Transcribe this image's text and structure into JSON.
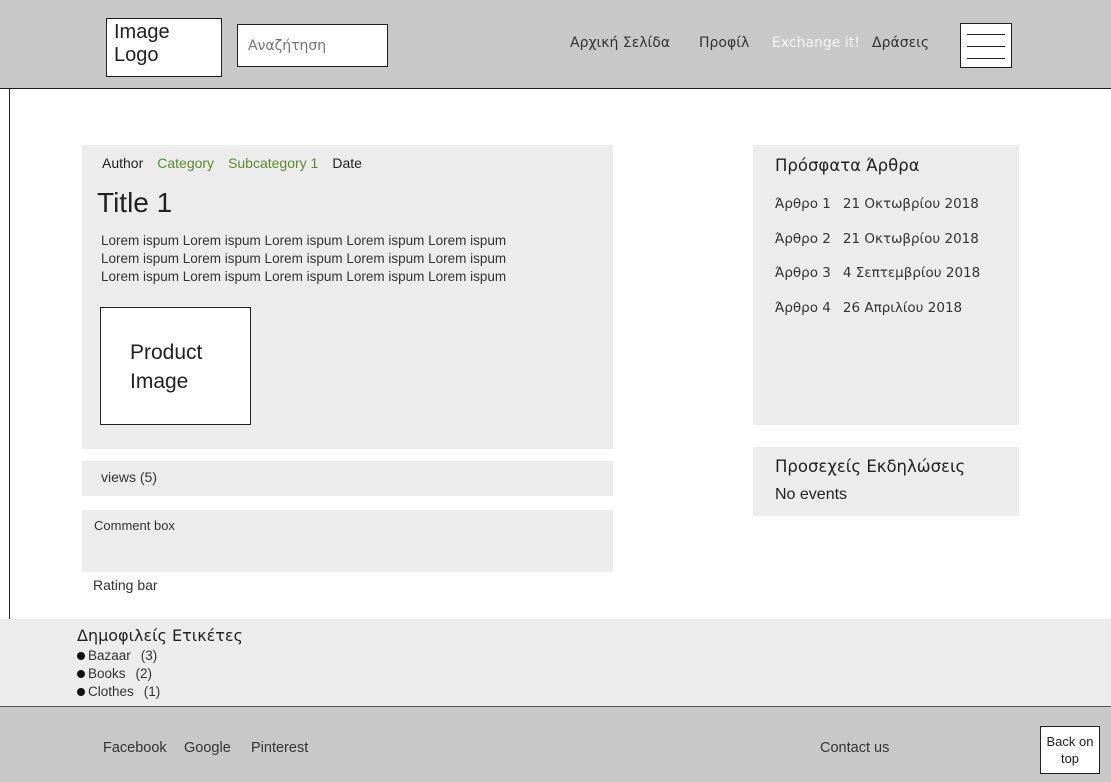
{
  "header": {
    "logo_text": "Image\nLogo",
    "search_placeholder": "Αναζήτηση",
    "nav": [
      "Αρχική Σελίδα",
      "Προφίλ",
      "Exchange it!",
      "Δράσεις"
    ],
    "menu_icon": "hamburger-menu-icon"
  },
  "post": {
    "meta": {
      "author": "Author",
      "category": "Category",
      "subcategory": "Subcategory 1",
      "date": "Date"
    },
    "title": "Title 1",
    "body": "Lorem ispum Lorem ispum Lorem ispum Lorem ispum Lorem ispum\nLorem ispum Lorem ispum Lorem ispum Lorem ispum Lorem ispum\nLorem ispum Lorem ispum Lorem ispum Lorem ispum Lorem ispum",
    "image_placeholder": "Product\nImage",
    "views": "views (5)",
    "comment_box": "Comment box",
    "rating_bar": "Rating bar"
  },
  "sidebar": {
    "recent_title": "Πρόσφατα Άρθρα",
    "recent": [
      {
        "title": "Άρθρο 1",
        "date": "21 Οκτωβρίου 2018"
      },
      {
        "title": "Άρθρο 2",
        "date": "21 Οκτωβρίου 2018"
      },
      {
        "title": "Άρθρο 3",
        "date": "4 Σεπτεμβρίου 2018"
      },
      {
        "title": "Άρθρο 4",
        "date": "26 Απριλίου 2018"
      }
    ],
    "events_title": "Προσεχείς Εκδηλώσεις",
    "events_text": "No events"
  },
  "tags": {
    "title": "Δημοφιλείς Ετικέτες",
    "items": [
      {
        "name": "Bazaar",
        "count": "(3)"
      },
      {
        "name": "Books",
        "count": "(2)"
      },
      {
        "name": "Clothes",
        "count": "(1)"
      }
    ]
  },
  "footer": {
    "links": [
      "Facebook",
      "Google",
      "Pinterest"
    ],
    "contact": "Contact us",
    "back_to_top": "Back on\ntop"
  },
  "colors": {
    "header_bg": "#c8c8c8",
    "panel_bg": "#ececec",
    "accent_green": "#5b8a2c"
  }
}
